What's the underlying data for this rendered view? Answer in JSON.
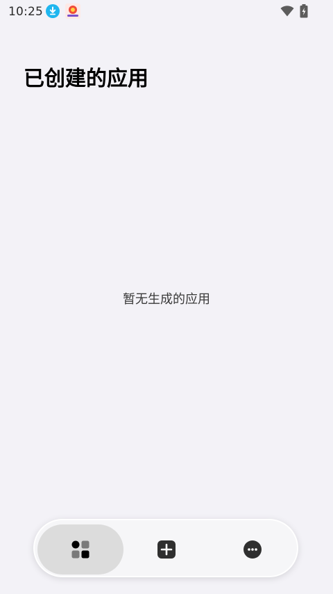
{
  "status_bar": {
    "time": "10:25",
    "icons": [
      "download-notification-icon",
      "app-notification-icon",
      "wifi-icon",
      "battery-charging-icon"
    ]
  },
  "page": {
    "title": "已创建的应用",
    "empty_message": "暂无生成的应用"
  },
  "bottom_nav": {
    "items": [
      {
        "icon": "apps-grid-icon",
        "active": true
      },
      {
        "icon": "plus-square-icon",
        "active": false
      },
      {
        "icon": "more-dots-icon",
        "active": false
      }
    ]
  },
  "colors": {
    "background": "#f3f2f7",
    "nav_active": "#dcdcdc",
    "download_badge": "#1fb6ef",
    "icon_dark": "#2f2f2f"
  }
}
